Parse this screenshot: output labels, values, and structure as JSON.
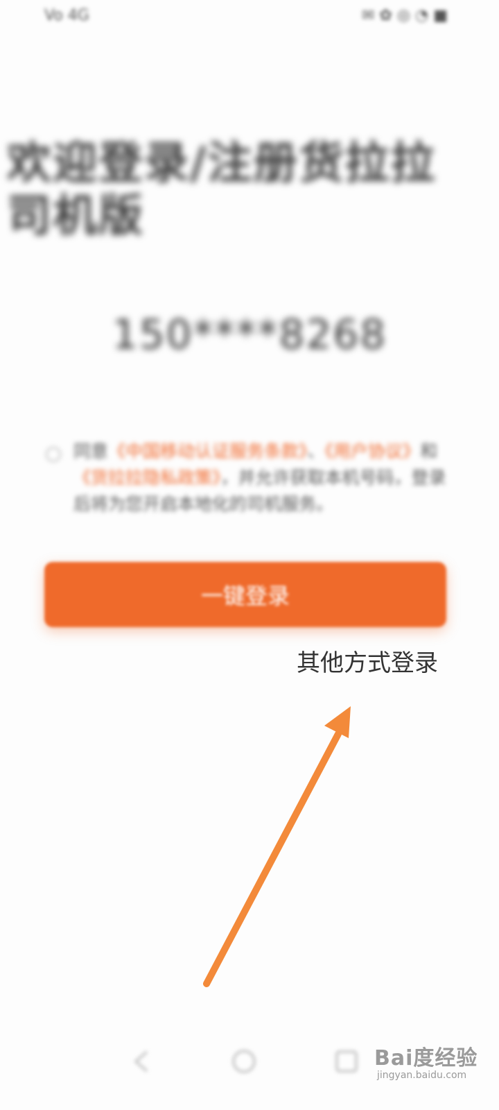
{
  "status_bar": {
    "left": "Vo 4G",
    "right": "✉ ✿ ◎ ◔ ■"
  },
  "login": {
    "welcome_title": "欢迎登录/注册货拉拉司机版",
    "phone_number": "150****8268",
    "agreement": {
      "prefix": "同意",
      "link1": "《中国移动认证服务条款》",
      "sep1": "、",
      "link2": "《用户协议》",
      "sep2": "和",
      "link3": "《货拉拉隐私政策》",
      "suffix": "，并允许获取本机号码，登录后将为您开启本地化的司机服务。"
    },
    "onekey_button": "一键登录",
    "other_login": "其他方式登录"
  },
  "annotation": {
    "arrow_color": "#f38a3a"
  },
  "watermark": {
    "logo": "Bai度经验",
    "url": "jingyan.baidu.com"
  }
}
